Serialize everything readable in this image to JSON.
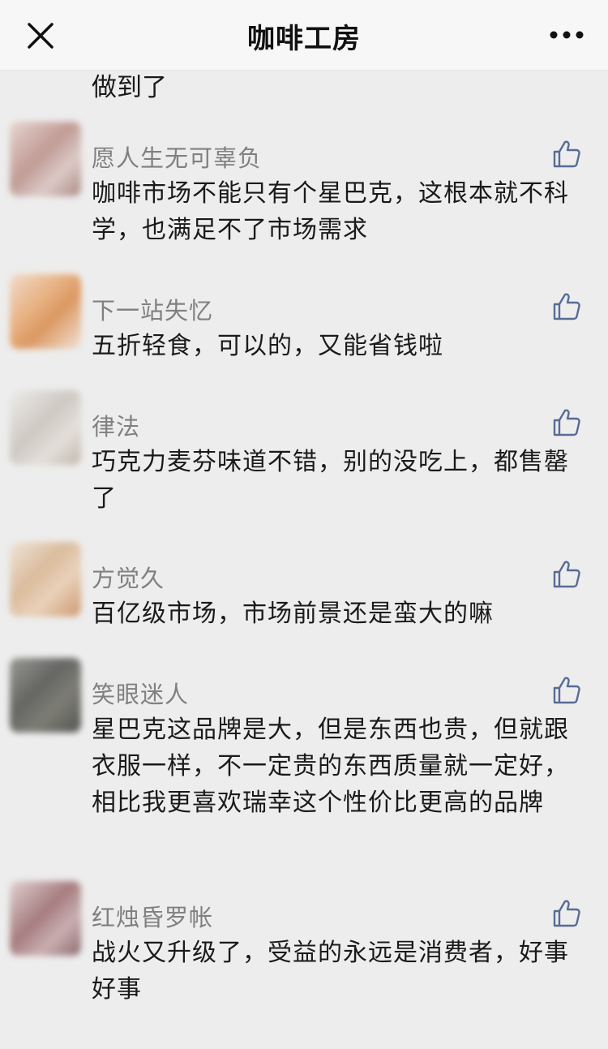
{
  "header": {
    "title": "咖啡工房",
    "close_icon": "close-icon",
    "more_icon": "more-icon"
  },
  "top_fragment": "做到了",
  "comments": [
    {
      "name": "愿人生无可辜负",
      "text": "咖啡市场不能只有个星巴克，这根本就不科学，也满足不了市场需求"
    },
    {
      "name": "下一站失忆",
      "text": "五折轻食，可以的，又能省钱啦"
    },
    {
      "name": "律法",
      "text": "巧克力麦芬味道不错，别的没吃上，都售罄了"
    },
    {
      "name": "方觉久",
      "text": "百亿级市场，市场前景还是蛮大的嘛"
    },
    {
      "name": "笑眼迷人",
      "text": "星巴克这品牌是大，但是东西也贵，但就跟衣服一样，不一定贵的东西质量就一定好，相比我更喜欢瑞幸这个性价比更高的品牌"
    },
    {
      "name": "红烛昏罗帐",
      "text": "战火又升级了，受益的永远是消费者，好事好事"
    }
  ],
  "colors": {
    "background": "#ededed",
    "name": "#808080",
    "text": "#1a1a1a",
    "like_icon": "#576b95"
  }
}
